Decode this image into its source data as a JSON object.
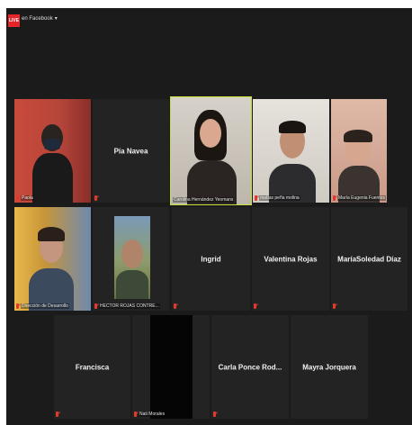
{
  "stream": {
    "live_label": "LIVE",
    "source_label": "en Facebook"
  },
  "participants": [
    {
      "name": "Paola",
      "kind": "video"
    },
    {
      "name": "Pía Navea",
      "kind": "name"
    },
    {
      "name": "Carolina Hernández Yeomans",
      "kind": "video",
      "active": true
    },
    {
      "name": "matías peña molina",
      "kind": "video"
    },
    {
      "name": "María Eugenia Fuentes",
      "kind": "video"
    },
    {
      "name": "Dirección de Desarrollo",
      "kind": "video"
    },
    {
      "name": "HECTOR ROJAS CONTRE...",
      "kind": "video"
    },
    {
      "name": "Ingrid",
      "kind": "name"
    },
    {
      "name": "Valentina Rojas",
      "kind": "name"
    },
    {
      "name": "MaríaSoledad Díaz",
      "kind": "name"
    },
    {
      "name": "Francisca",
      "kind": "name"
    },
    {
      "name": "Nati Morales",
      "kind": "video-black"
    },
    {
      "name": "Carla Ponce Rod...",
      "kind": "name"
    },
    {
      "name": "Mayra Jorquera",
      "kind": "name"
    }
  ],
  "colors": {
    "live_red": "#e5252a",
    "active_speaker_border": "#c8e03a",
    "muted_mic": "#e03a2f"
  },
  "icons": [
    "live-badge",
    "muted-mic-icon",
    "chevron-down-icon"
  ]
}
